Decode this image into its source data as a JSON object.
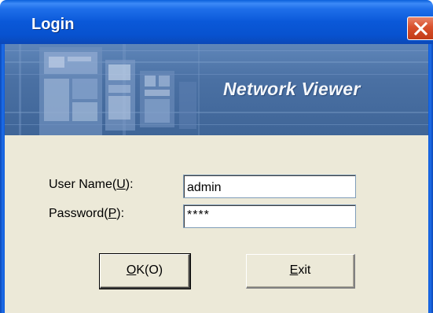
{
  "window": {
    "title": "Login",
    "close_label": "close"
  },
  "banner": {
    "title": "Network Viewer"
  },
  "form": {
    "username_label_prefix": "User Name(",
    "username_label_key": "U",
    "username_label_suffix": "):",
    "username_value": "admin",
    "password_label_prefix": "Password(",
    "password_label_key": "P",
    "password_label_suffix": "):",
    "password_value": "****"
  },
  "buttons": {
    "ok_key": "O",
    "ok_rest": "K(O)",
    "exit_key": "E",
    "exit_rest": "xit"
  },
  "colors": {
    "titlebar": "#0a58d8",
    "banner": "#4a70a3",
    "dialog_bg": "#ece9d8",
    "close_button": "#d8502c"
  },
  "icons": {
    "close": "close-icon"
  }
}
